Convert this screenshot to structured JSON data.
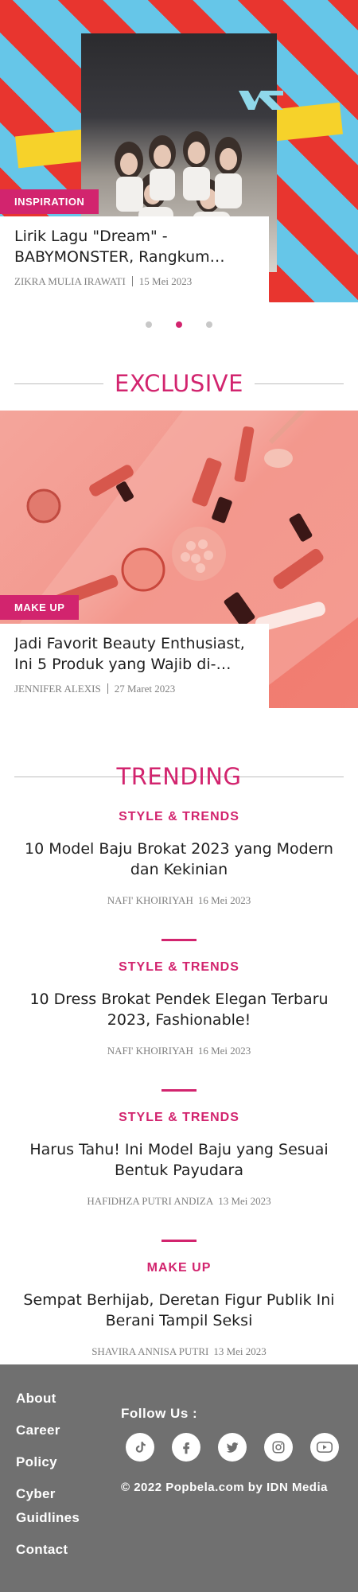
{
  "hero": {
    "category": "INSPIRATION",
    "title": "Lirik Lagu \"Dream\" - BABYMONSTER, Rangkum…",
    "author": "ZIKRA MULIA IRAWATI",
    "date": "15 Mei 2023",
    "carousel": {
      "count": 3,
      "active": 2
    }
  },
  "exclusive": {
    "heading": "EXCLUSIVE",
    "category": "MAKE UP",
    "title": "Jadi Favorit Beauty Enthusiast, Ini 5 Produk yang Wajib di-…",
    "author": "JENNIFER ALEXIS",
    "date": "27 Maret 2023"
  },
  "trending": {
    "heading": "TRENDING",
    "items": [
      {
        "category": "STYLE & TRENDS",
        "title": "10 Model Baju Brokat 2023 yang Modern dan Kekinian",
        "author": "NAFI' KHOIRIYAH",
        "date": "16 Mei 2023"
      },
      {
        "category": "STYLE & TRENDS",
        "title": "10 Dress Brokat Pendek Elegan Terbaru 2023, Fashionable!",
        "author": "NAFI' KHOIRIYAH",
        "date": "16 Mei 2023"
      },
      {
        "category": "STYLE & TRENDS",
        "title": "Harus Tahu! Ini Model Baju yang Sesuai Bentuk Payudara",
        "author": "HAFIDHZA PUTRI ANDIZA",
        "date": "13 Mei 2023"
      },
      {
        "category": "MAKE UP",
        "title": "Sempat Berhijab, Deretan Figur Publik Ini Berani Tampil Seksi",
        "author": "SHAVIRA ANNISA PUTRI",
        "date": "13 Mei 2023"
      }
    ]
  },
  "footer": {
    "links": [
      "About",
      "Career",
      "Policy",
      "Cyber Guidlines",
      "Contact"
    ],
    "follow_label": "Follow Us :",
    "socials": [
      "tiktok-icon",
      "facebook-icon",
      "twitter-icon",
      "instagram-icon",
      "youtube-icon"
    ],
    "copyright": "© 2022 Popbela.com by IDN Media"
  },
  "colors": {
    "accent": "#d2246e",
    "footer_bg": "#707070",
    "meta_text": "#808080"
  }
}
